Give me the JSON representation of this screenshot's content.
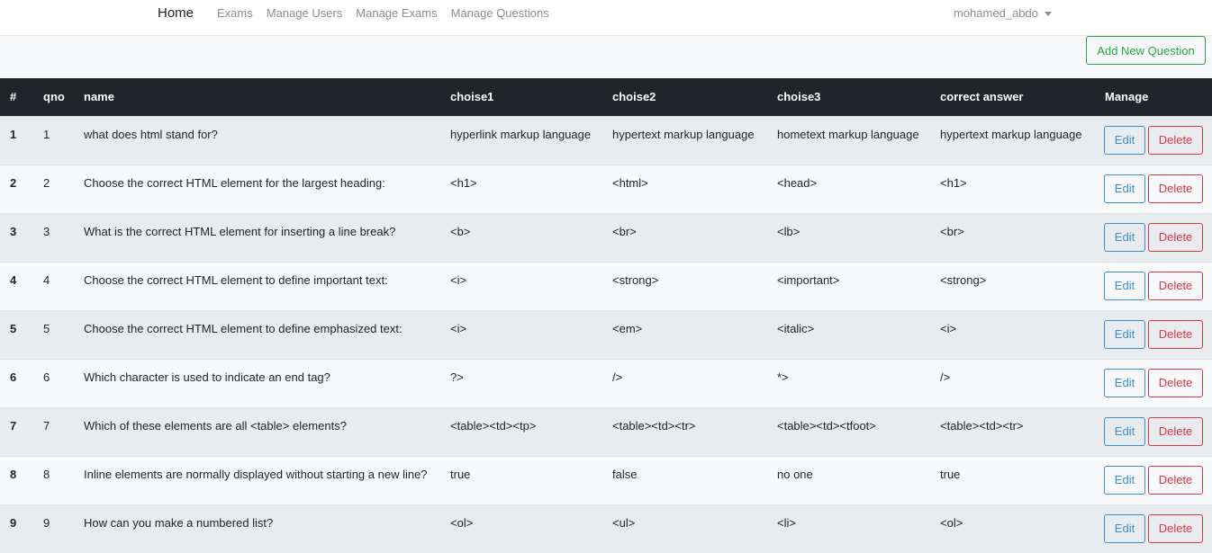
{
  "navbar": {
    "brand": "Home",
    "links": [
      "Exams",
      "Manage Users",
      "Manage Exams",
      "Manage Questions"
    ],
    "user": "mohamed_abdo"
  },
  "actions": {
    "add_label": "Add New Question"
  },
  "table": {
    "columns": [
      "#",
      "qno",
      "name",
      "choise1",
      "choise2",
      "choise3",
      "correct answer",
      "Manage"
    ],
    "edit_label": "Edit",
    "delete_label": "Delete",
    "rows": [
      {
        "index": "1",
        "qno": "1",
        "name": "what does html stand for?",
        "choice1": "hyperlink markup language",
        "choice2": "hypertext markup language",
        "choice3": "hometext markup language",
        "correct": "hypertext markup language"
      },
      {
        "index": "2",
        "qno": "2",
        "name": "Choose the correct HTML element for the largest heading:",
        "choice1": "<h1>",
        "choice2": "<html>",
        "choice3": "<head>",
        "correct": "<h1>"
      },
      {
        "index": "3",
        "qno": "3",
        "name": "What is the correct HTML element for inserting a line break?",
        "choice1": "<b>",
        "choice2": "<br>",
        "choice3": "<lb>",
        "correct": "<br>"
      },
      {
        "index": "4",
        "qno": "4",
        "name": "Choose the correct HTML element to define important text:",
        "choice1": "<i>",
        "choice2": "<strong>",
        "choice3": "<important>",
        "correct": "<strong>"
      },
      {
        "index": "5",
        "qno": "5",
        "name": "Choose the correct HTML element to define emphasized text:",
        "choice1": "<i>",
        "choice2": "<em>",
        "choice3": "<italic>",
        "correct": "<i>"
      },
      {
        "index": "6",
        "qno": "6",
        "name": "Which character is used to indicate an end tag?",
        "choice1": "?>",
        "choice2": "/>",
        "choice3": "*>",
        "correct": "/>"
      },
      {
        "index": "7",
        "qno": "7",
        "name": "Which of these elements are all <table> elements?",
        "choice1": "<table><td><tp>",
        "choice2": "<table><td><tr>",
        "choice3": "<table><td><tfoot>",
        "correct": "<table><td><tr>"
      },
      {
        "index": "8",
        "qno": "8",
        "name": "Inline elements are normally displayed without starting a new line?",
        "choice1": "true",
        "choice2": "false",
        "choice3": "no one",
        "correct": "true"
      },
      {
        "index": "9",
        "qno": "9",
        "name": "How can you make a numbered list?",
        "choice1": "<ol>",
        "choice2": "<ul>",
        "choice3": "<li>",
        "correct": "<ol>"
      }
    ]
  }
}
